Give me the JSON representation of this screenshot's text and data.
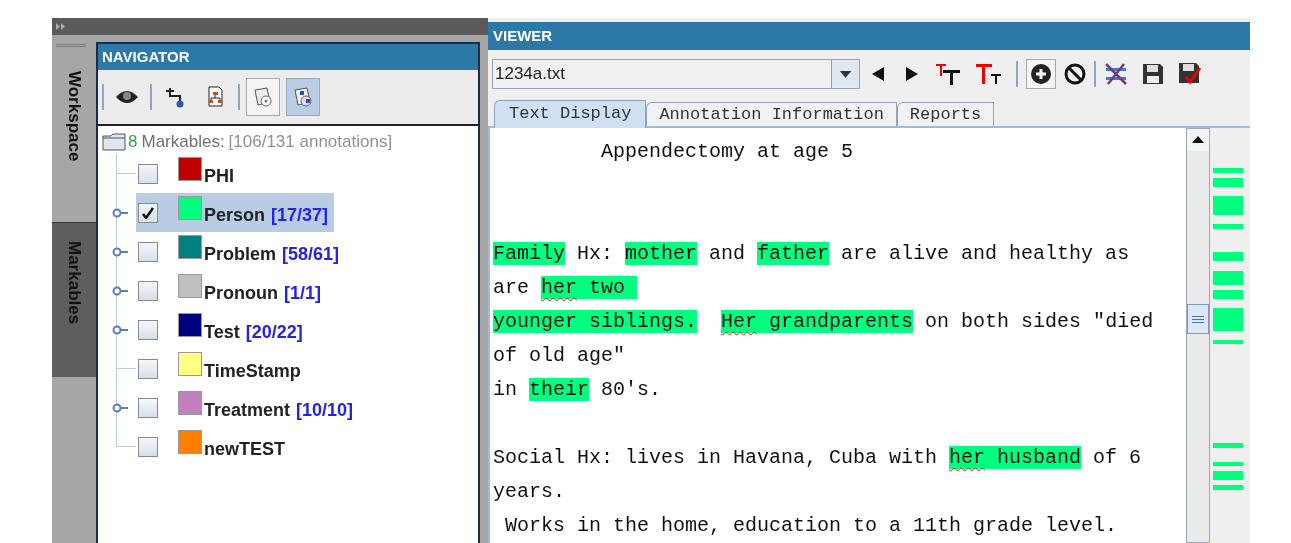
{
  "side_tabs": [
    {
      "label": "Workspace",
      "selected": false
    },
    {
      "label": "Markables",
      "selected": true
    }
  ],
  "navigator": {
    "title": "NAVIGATOR",
    "toolbar": [
      {
        "kind": "eye",
        "pressed": false
      },
      {
        "kind": "tree-add",
        "pressed": false
      },
      {
        "kind": "doc-tree",
        "pressed": false
      },
      {
        "kind": "clip-circle",
        "pressed": false
      },
      {
        "kind": "clip-ab",
        "pressed": true
      }
    ],
    "root": {
      "count": "8",
      "label": "Markables:",
      "summary": "[106/131 annotations]"
    },
    "items": [
      {
        "label": "PHI",
        "color": "#c00000",
        "checked": false,
        "selected": false,
        "expandable": false
      },
      {
        "label": "Person",
        "count": "[17/37]",
        "color": "#00ff7f",
        "checked": true,
        "selected": true,
        "expandable": true
      },
      {
        "label": "Problem",
        "count": "[58/61]",
        "color": "#008080",
        "checked": false,
        "selected": false,
        "expandable": true
      },
      {
        "label": "Pronoun",
        "count": "[1/1]",
        "color": "#c0c0c0",
        "checked": false,
        "selected": false,
        "expandable": true
      },
      {
        "label": "Test",
        "count": "[20/22]",
        "color": "#000080",
        "checked": false,
        "selected": false,
        "expandable": true
      },
      {
        "label": "TimeStamp",
        "color": "#ffff80",
        "checked": false,
        "selected": false,
        "expandable": false
      },
      {
        "label": "Treatment",
        "count": "[10/10]",
        "color": "#c080c0",
        "checked": false,
        "selected": false,
        "expandable": true
      },
      {
        "label": "newTEST",
        "color": "#ff8000",
        "checked": false,
        "selected": false,
        "expandable": false
      }
    ]
  },
  "viewer": {
    "title": "VIEWER",
    "file": "1234a.txt",
    "tabs": [
      {
        "label": "Text Display",
        "selected": true
      },
      {
        "label": "Annotation Information",
        "selected": false
      },
      {
        "label": "Reports",
        "selected": false
      }
    ],
    "lines": [
      {
        "kind": "text",
        "segments": [
          {
            "text": "         Appendectomy at age 5",
            "highlight": false
          }
        ]
      },
      {
        "kind": "blank"
      },
      {
        "kind": "blank"
      },
      {
        "kind": "text",
        "segments": [
          {
            "text": "Family",
            "highlight": true
          },
          {
            "text": " Hx: ",
            "highlight": false
          },
          {
            "text": "mother",
            "highlight": true
          },
          {
            "text": " and ",
            "highlight": false
          },
          {
            "text": "father",
            "highlight": true
          },
          {
            "text": " are alive and healthy as",
            "highlight": false
          }
        ]
      },
      {
        "kind": "text",
        "segments": [
          {
            "text": "are ",
            "highlight": false
          },
          {
            "text": "her",
            "highlight": true,
            "squiggle": true
          },
          {
            "text": " two ",
            "highlight": true
          }
        ]
      },
      {
        "kind": "text",
        "segments": [
          {
            "text": "younger siblings.",
            "highlight": true,
            "gap_after": true
          },
          {
            "text": "Her",
            "highlight": true,
            "squiggle": true
          },
          {
            "text": " grandparents",
            "highlight": true
          },
          {
            "text": " on both sides \"died",
            "highlight": false
          }
        ]
      },
      {
        "kind": "text",
        "segments": [
          {
            "text": "of old age\"",
            "highlight": false
          }
        ]
      },
      {
        "kind": "text",
        "segments": [
          {
            "text": "in ",
            "highlight": false
          },
          {
            "text": "their",
            "highlight": true
          },
          {
            "text": " 80's.",
            "highlight": false
          }
        ]
      },
      {
        "kind": "blank"
      },
      {
        "kind": "text",
        "segments": [
          {
            "text": "Social Hx: lives in Havana, Cuba with ",
            "highlight": false
          },
          {
            "text": "her",
            "highlight": true,
            "squiggle": true
          },
          {
            "text": " husband",
            "highlight": true
          },
          {
            "text": " of 6",
            "highlight": false
          }
        ]
      },
      {
        "kind": "text",
        "segments": [
          {
            "text": "years.",
            "highlight": false
          }
        ]
      },
      {
        "kind": "text",
        "segments": [
          {
            "text": " Works in the home, education to a 11th grade level.",
            "highlight": false
          }
        ]
      }
    ]
  }
}
